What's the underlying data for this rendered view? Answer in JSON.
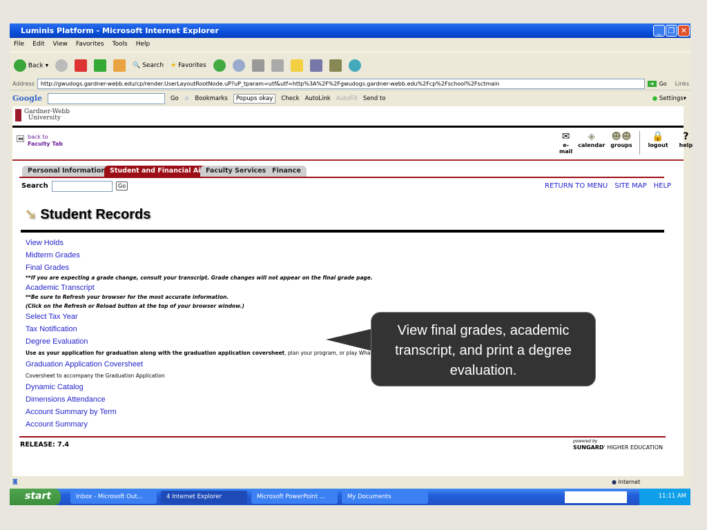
{
  "window": {
    "title": "Luminis Platform - Microsoft Internet Explorer"
  },
  "menu": [
    "File",
    "Edit",
    "View",
    "Favorites",
    "Tools",
    "Help"
  ],
  "toolbar": {
    "back": "Back",
    "search": "Search",
    "favorites": "Favorites"
  },
  "address": {
    "label": "Address",
    "url": "http://gwudogs.gardner-webb.edu/cp/render.UserLayoutRootNode.uP?uP_tparam=utf&utf=http%3A%2F%2Fgwudogs.gardner-webb.edu%2Fcp%2Fschool%2Fsctmain",
    "go": "Go",
    "links": "Links"
  },
  "google": {
    "logo": "Google",
    "go": "Go",
    "bookmarks": "Bookmarks",
    "popups": "Popups okay",
    "check": "Check",
    "autolink": "AutoLink",
    "autofill": "AutoFill",
    "sendto": "Send to",
    "settings": "Settings"
  },
  "page": {
    "logo_line1": "Gardner-Webb",
    "logo_line2": "University",
    "back_to": "back to",
    "faculty_tab": "Faculty Tab",
    "top_icons": [
      "e-mail",
      "calendar",
      "groups",
      "logout",
      "help"
    ],
    "tabs": [
      "Personal Information",
      "Student and Financial Aid",
      "Faculty Services",
      "Finance"
    ],
    "search_label": "Search",
    "search_go": "Go",
    "right_links": [
      "RETURN TO MENU",
      "SITE MAP",
      "HELP"
    ],
    "title": "Student Records",
    "items": [
      {
        "link": "View Holds"
      },
      {
        "link": "Midterm Grades"
      },
      {
        "link": "Final Grades",
        "notes": [
          "**If you are expecting a grade change, consult your transcript. Grade changes will not appear on the final grade page."
        ]
      },
      {
        "link": "Academic Transcript",
        "notes": [
          "**Be sure to Refresh your browser for the most accurate information.",
          "(Click on the Refresh or Reload button at the top of your browser window.)"
        ]
      },
      {
        "link": "Select Tax Year"
      },
      {
        "link": "Tax Notification"
      },
      {
        "link": "Degree Evaluation"
      },
      {
        "link": "Graduation Application Coversheet"
      },
      {
        "link": "Dynamic Catalog"
      },
      {
        "link": "Dimensions Attendance"
      },
      {
        "link": "Account Summary by Term"
      },
      {
        "link": "Account Summary"
      }
    ],
    "degree_desc_bold": "Use as your application for graduation along with the graduation application coversheet",
    "degree_desc_rest": ", plan your program, or play What-if",
    "coversheet_desc": "Coversheet to accompany the Graduation Application",
    "release": "RELEASE: 7.4",
    "powered_by": "powered by",
    "sungard": "SUNGARD",
    "higher_ed": "HIGHER EDUCATION"
  },
  "status": {
    "zone": "Internet"
  },
  "taskbar": {
    "start": "start",
    "tasks": [
      "Inbox - Microsoft Out...",
      "4 Internet Explorer",
      "Microsoft PowerPoint ...",
      "My Documents"
    ],
    "clock": "11:11 AM"
  },
  "callout": {
    "text": "View  final grades, academic transcript, and print a degree evaluation."
  }
}
